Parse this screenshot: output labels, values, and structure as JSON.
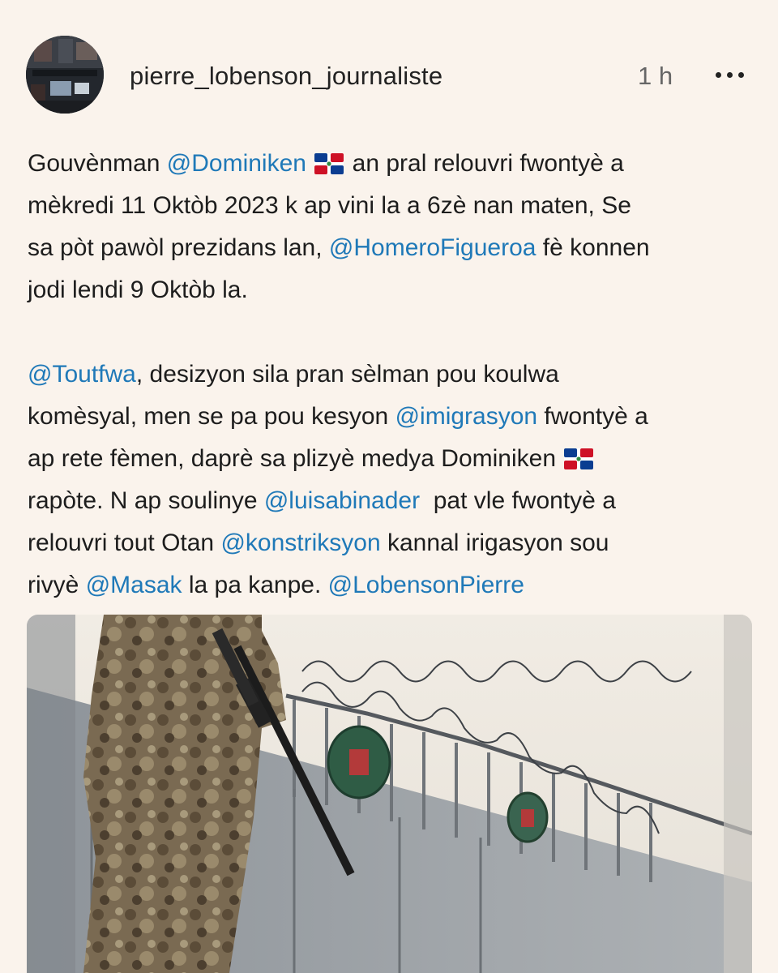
{
  "post": {
    "username": "pierre_lobenson_journaliste",
    "timestamp": "1 h",
    "more_icon": "more-horizontal-icon",
    "paragraph1": {
      "l1_a": "Gouvènman ",
      "l1_mention": "@Dominiken",
      "l1_b": " an pral relouvri fwontyè a",
      "l2": "mèkredi 11 Oktòb 2023 k ap vini la a 6zè nan maten, Se",
      "l3_a": "sa pòt pawòl prezidans lan, ",
      "l3_mention": "@HomeroFigueroa",
      "l3_b": " fè konnen",
      "l4": "jodi lendi 9 Oktòb la."
    },
    "paragraph2": {
      "l1_mention": "@Toutfwa",
      "l1_b": ", desizyon sila pran sèlman pou koulwa",
      "l2_a": "komèsyal, men se pa pou kesyon ",
      "l2_mention": "@imigrasyon",
      "l2_b": " fwontyè a",
      "l3": "ap rete fèmen, daprè sa plizyè medya Dominiken ",
      "l4_a": "rapòte. N ap soulinye ",
      "l4_mention": "@luisabinader",
      "l4_b": "  pat vle fwontyè a",
      "l5_a": "relouvri tout Otan ",
      "l5_mention": "@konstriksyon",
      "l5_b": " kannal irigasyon sou",
      "l6_a": "rivyè ",
      "l6_mention": "@Masak",
      "l6_b": " la pa kanpe. ",
      "l6_mention2": "@LobensonPierre"
    },
    "flag_icon": "dominican-republic-flag-icon"
  },
  "colors": {
    "background": "#faf3ec",
    "mention": "#1f79b8",
    "text": "#1d1d1d"
  }
}
